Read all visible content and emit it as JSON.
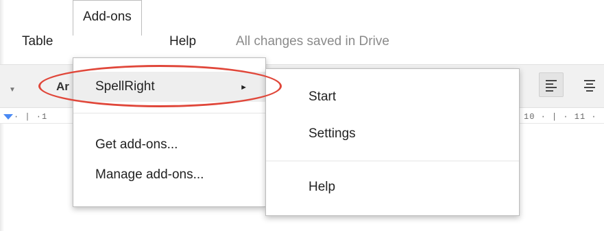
{
  "menubar": {
    "items": [
      {
        "label": "Table"
      },
      {
        "label": "Add-ons"
      },
      {
        "label": "Help"
      }
    ],
    "save_status": "All changes saved in Drive"
  },
  "toolbar": {
    "font_name_visible": "Ar",
    "ruler_left": "1",
    "ruler_right": "10 · | · 11 ·"
  },
  "addons_menu": {
    "items": [
      {
        "label": "SpellRight",
        "has_submenu": true,
        "highlighted": true
      },
      {
        "label": "Get add-ons..."
      },
      {
        "label": "Manage add-ons..."
      }
    ],
    "submenu_arrow": "►"
  },
  "submenu": {
    "items": [
      {
        "label": "Start"
      },
      {
        "label": "Settings"
      },
      {
        "label": "Help"
      }
    ]
  },
  "annotation_color": "#e0473a"
}
